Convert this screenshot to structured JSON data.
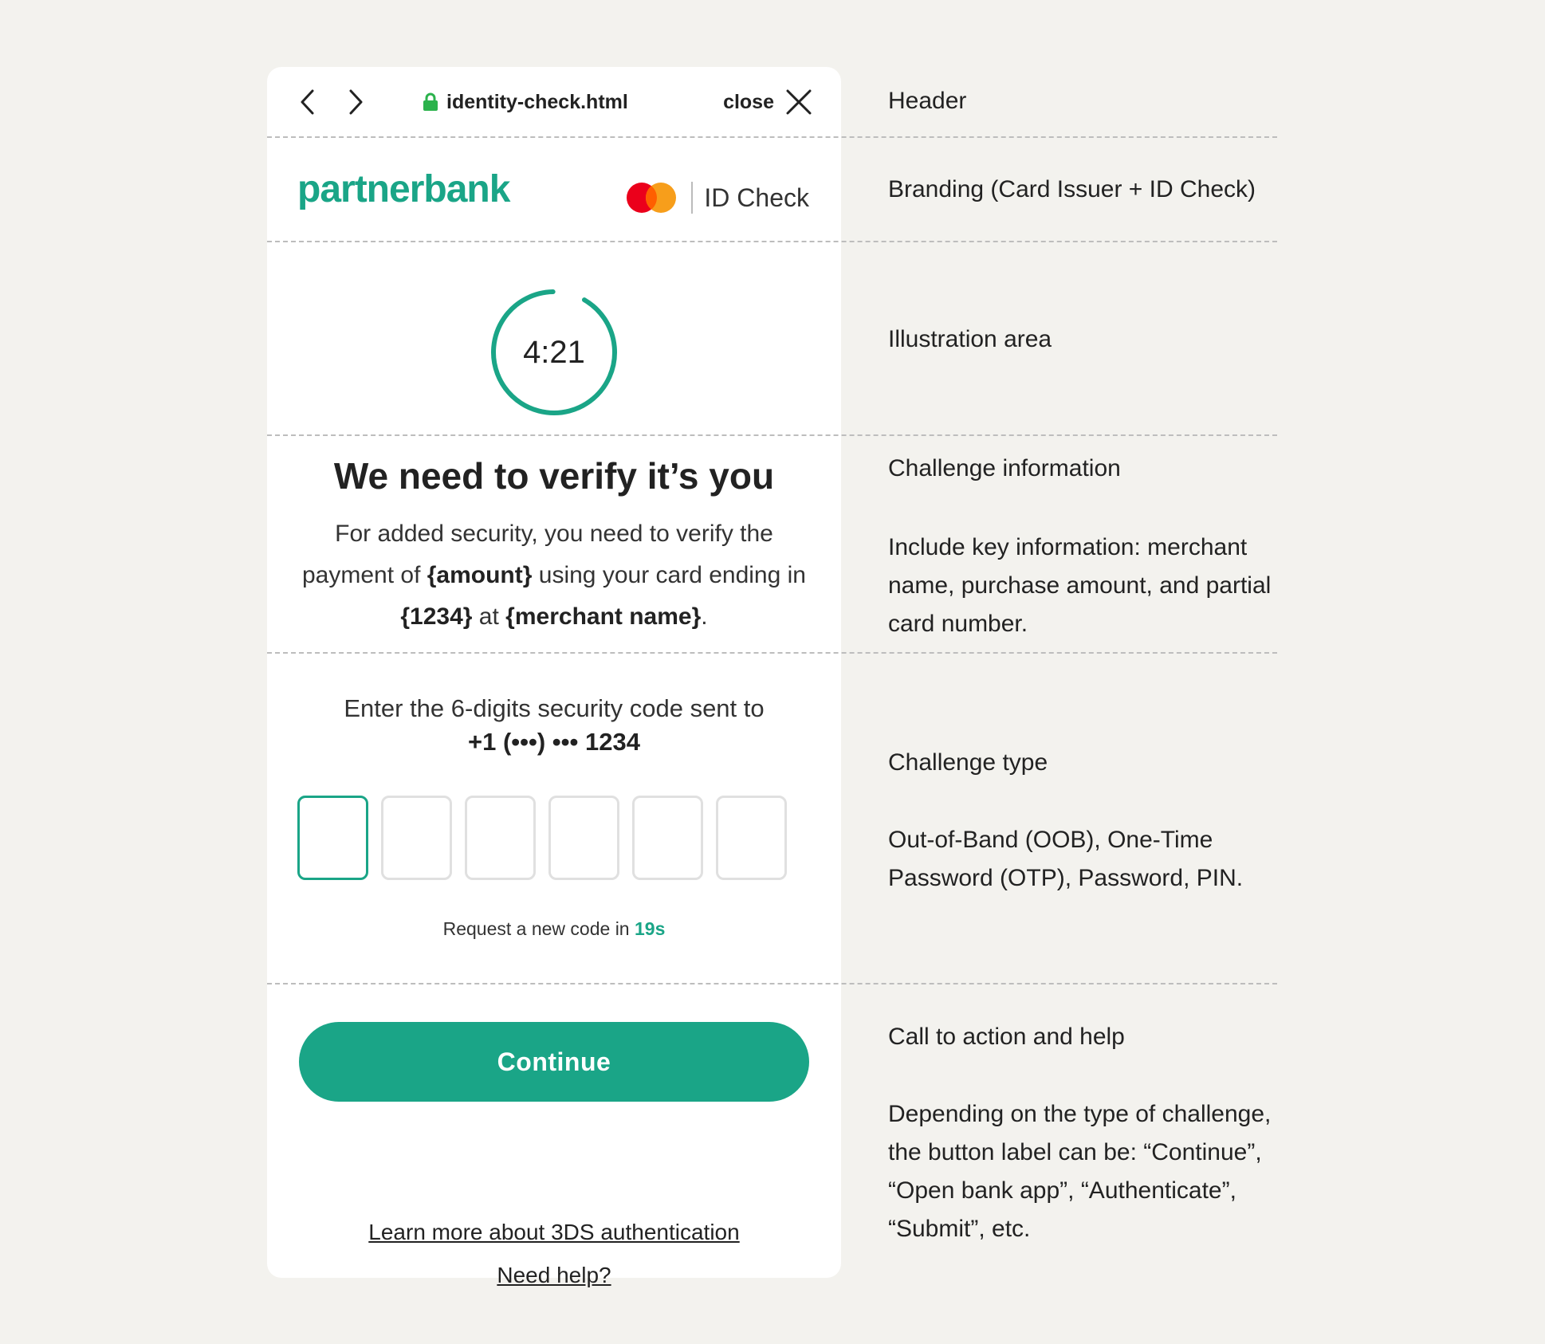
{
  "header": {
    "url": "identity-check.html",
    "close_label": "close"
  },
  "branding": {
    "issuer": "partnerbank",
    "id_check": "ID Check"
  },
  "illustration": {
    "timer": "4:21",
    "progress_fraction": 0.95,
    "accent_color": "#1aa587"
  },
  "challenge_info": {
    "title": "We need to verify it’s you",
    "desc_1": "For added security, you need to verify the payment of ",
    "amount": "{amount}",
    "desc_2": " using your card ending in ",
    "card_last4": "{1234}",
    "desc_3": " at ",
    "merchant": "{merchant name}",
    "desc_4": "."
  },
  "challenge_type": {
    "instruction": "Enter the 6-digits security code sent to",
    "phone": "+1 (•••) ••• 1234",
    "otp_digits": [
      "",
      "",
      "",
      "",
      "",
      ""
    ],
    "resend_text": "Request a new code in ",
    "resend_seconds": "19s"
  },
  "cta": {
    "button_label": "Continue",
    "learn_more": "Learn more about 3DS authentication",
    "need_help": "Need help?"
  },
  "annotations": {
    "header": "Header",
    "branding": "Branding (Card Issuer + ID Check)",
    "illustration": "Illustration area",
    "challenge_info_title": "Challenge information",
    "challenge_info_body": "Include key information: merchant name, purchase amount, and partial card number.",
    "challenge_type_title": "Challenge type",
    "challenge_type_body": "Out-of-Band (OOB), One-Time Password (OTP), Password, PIN.",
    "cta_title": "Call to action and help",
    "cta_body": "Depending on the type of challenge, the button label can be: “Continue”, “Open bank app”, “Authenticate”, “Submit”, etc."
  }
}
